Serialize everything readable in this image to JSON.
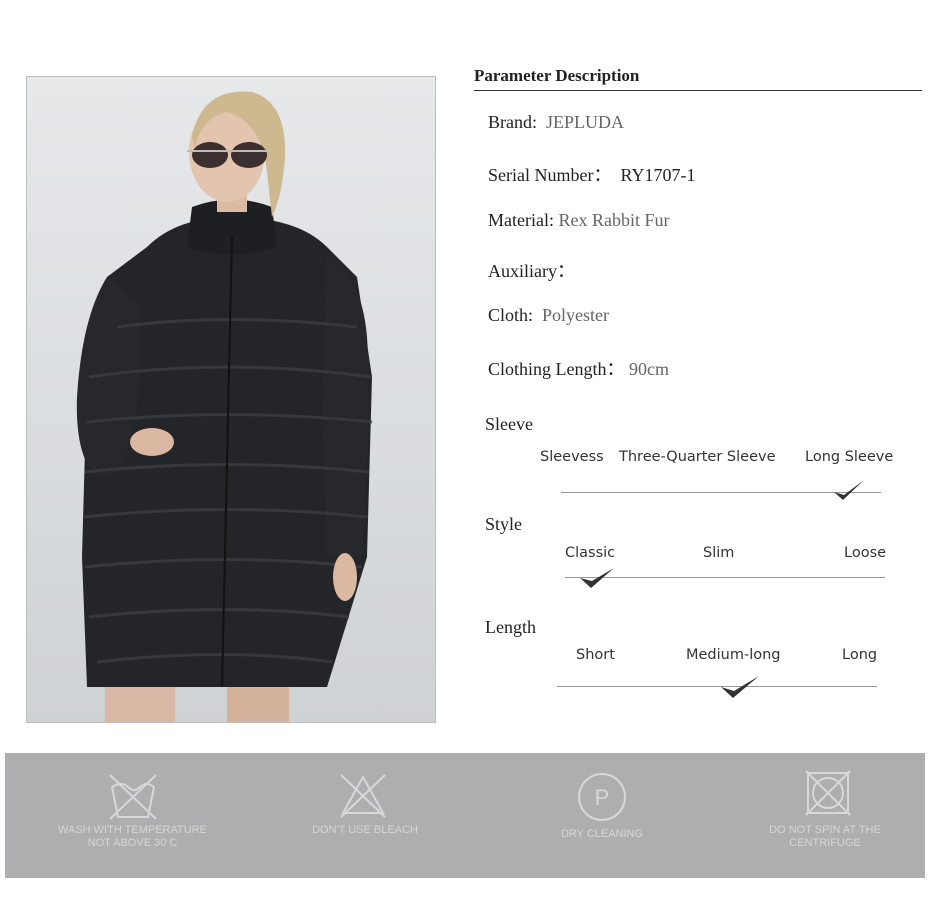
{
  "parameters": {
    "title": "Parameter Description",
    "brand_label": "Brand:",
    "brand_value": "JEPLUDA",
    "serial_label": "Serial Number：",
    "serial_value": "RY1707-1",
    "material_label": "Material:",
    "material_value": "Rex Rabbit Fur",
    "auxiliary_label": "Auxiliary：",
    "cloth_label": "Cloth:",
    "cloth_value": "Polyester",
    "length_label": "Clothing Length：",
    "length_value": "90cm"
  },
  "sleeve": {
    "title": "Sleeve",
    "options": [
      "Sleevess",
      "Three-Quarter Sleeve",
      "Long Sleeve"
    ],
    "selected": "Long Sleeve"
  },
  "style": {
    "title": "Style",
    "options": [
      "Classic",
      "Slim",
      "Loose"
    ],
    "selected": "Classic"
  },
  "length": {
    "title": "Length",
    "options": [
      "Short",
      "Medium-long",
      "Long"
    ],
    "selected": "Medium-long"
  },
  "care": {
    "items": [
      {
        "icon": "wash-30-icon",
        "line1": "WASH WITH TEMPERATURE",
        "line2": "NOT ABOVE 30 C"
      },
      {
        "icon": "no-bleach-icon",
        "line1": "DON'T USE BLEACH",
        "line2": ""
      },
      {
        "icon": "dry-clean-icon",
        "line1": "DRY CLEANING",
        "line2": ""
      },
      {
        "icon": "no-spin-icon",
        "line1": "DO NOT SPIN AT THE",
        "line2": "CENTRIFUGE"
      }
    ]
  },
  "colors": {
    "coat": "#222428",
    "care_bar": "#aeaeb0",
    "care_text": "#d6d6d6"
  }
}
